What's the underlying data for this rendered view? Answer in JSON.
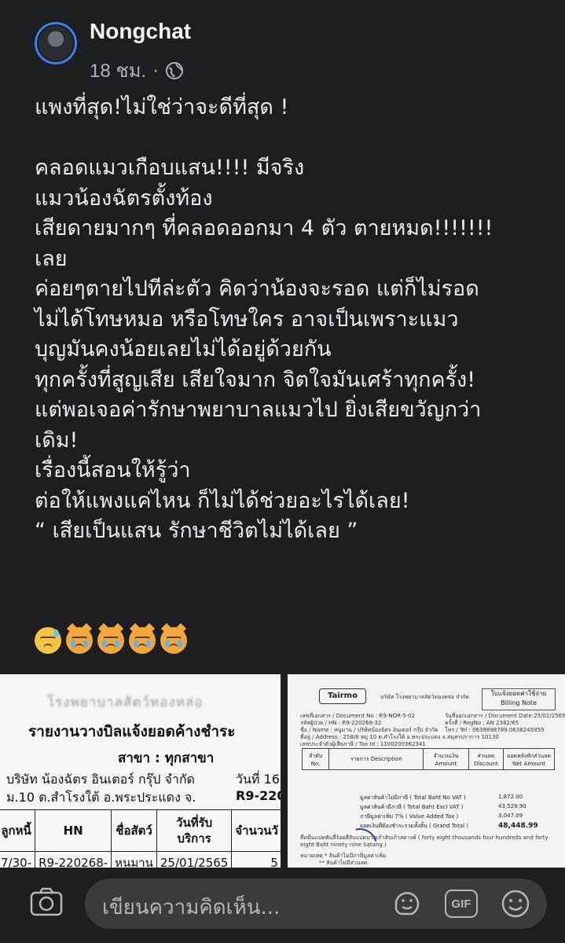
{
  "post": {
    "author": "Nongchat",
    "time": "18 ชม.",
    "separator": "·",
    "lines": [
      "แพงที่สุด!ไม่ใช่ว่าจะดีที่สุด !",
      "",
      "คลอดแมวเกือบแสน!!!! มีจริง",
      "แมวน้องฉัตรตั้งท้อง",
      "เสียดายมากๆ ที่คลอดออกมา 4 ตัว ตายหมด!!!!!!!",
      "เลย",
      "ค่อยๆตายไปทีล่ะตัว คิดว่าน้องจะรอด แต่ก็ไม่รอด",
      "ไม่ได้โทษหมอ หรือโทษใคร อาจเป็นเพราะแมว",
      "บุญมันคงน้อยเลยไม่ได้อยู่ด้วยกัน",
      "ทุกครั้งที่สูญเสีย เสียใจมาก จิตใจมันเศร้าทุกครั้ง!",
      "แต่พอเจอค่ารักษาพยาบาลแมวไป ยิ่งเสียขวัญกว่า",
      "เดิม!",
      "เรื่องนี้สอนให้รู้ว่า",
      "ต่อให้แพงแค่ไหน ก็ไม่ได้ช่วยอะไรได้เลย!",
      "“ เสียเป็นแสน รักษาชีวิตไม่ได้เลย ”"
    ],
    "emojis": [
      "downcast-sweat-face",
      "crying-cat-face",
      "crying-cat-face",
      "crying-cat-face",
      "crying-cat-face"
    ]
  },
  "image_left": {
    "header_blurred": "โรงพยาบาลสัตว์ทองหล่อ",
    "title": "รายงานวางบิลแจ้งยอดค้างชำระ",
    "branch": "สาขา : ทุกสาขา",
    "company": "บริษัท น้องฉัตร อินเตอร์ กรุ๊ป จำกัด",
    "date": "วันที่ 16 ส",
    "address": "ม.10  ต.สำโรงใต้ อ.พระประแดง จ.",
    "doc_no": "R9-220",
    "headers": [
      "ลูกหนี้",
      "HN",
      "ชื่อสัตว์",
      "วันที่รับบริการ",
      "จำนวนวั"
    ],
    "row": [
      "7/30-",
      "R9-220268-",
      "หนมาน",
      "25/01/2565",
      "5"
    ]
  },
  "image_right": {
    "logo": "Tairmo",
    "company_line": "บริษัท โรงพยาบาลสัตว์ทองหล่อ จำกัด",
    "bill_note_th": "ใบแจ้งยอดค่าใช้จ่าย",
    "bill_note_en": "Billing Note",
    "doc_no": "เลขที่เอกสาร / Document  No : R9-NOR-5-02",
    "hn": "รหัสผู้ป่วย / HN : R9-220268-32",
    "name": "ชื่อ / Name : หนูมาน / บริษัทน้องฉัตร อินเตอร์ กรุ๊ป จำกัด",
    "address": "ที่อยู่ / Address : 258/8 หมู่ 10 ต.สำโรงใต้ อ.พระประแดง จ.สมุทรปราการ 10130",
    "tax": "เลขประจำตัวผู้เสียภาษี / Tax Id : 1100200362341",
    "doc_date": "วันที่ออกเอกสาร / Document Date:25/02/2565",
    "visit": "ครั้งที่ / RegNo : AN 2382/65",
    "phone": "โทร / Tel : 0638898789.0636245959",
    "col_no": "ลำดับ No.",
    "col_desc": "รายการ Description",
    "col_amount": "จำนวนเงิน Amount",
    "col_discount": "ส่วนลด Discount",
    "col_net": "ยอดหลังหักส่วนลด Net Amount",
    "sum_labels": [
      "มูลค่าสินค้าไม่มีภาษี ( Total Baht No VAT )",
      "มูลค่าสินค้ามีภาษี ( Total Baht Excl VAT )",
      "ภาษีมูลค่าเพิ่ม 7% ( Value Added Tax )",
      "ยอดเงินที่ต้องชำระรวมทั้งสิ้น ( Grand Total )"
    ],
    "sum_values": [
      "1,872.00",
      "43,529.90",
      "3,047.09",
      "48,448.99"
    ],
    "words": "สี่หมื่นแปดพันสี่ร้อยสี่สิบแปดบาทเก้าสิบเก้าสตางค์ ( forty eight thousands four hundreds and forty eight Baht ninety nine Satang )",
    "footnote1": "หมายเหตุ  * สินค้าไม่มีภาษีมูลค่าเพิ่ม",
    "footnote2": "** สินค้าไม่มีส่วนลด"
  },
  "comment": {
    "placeholder": "เขียนความคิดเห็น...",
    "camera_icon": "camera-icon",
    "sticker_icon": "sticker-icon",
    "gif_label": "GIF",
    "emoji_icon": "emoji-icon"
  }
}
